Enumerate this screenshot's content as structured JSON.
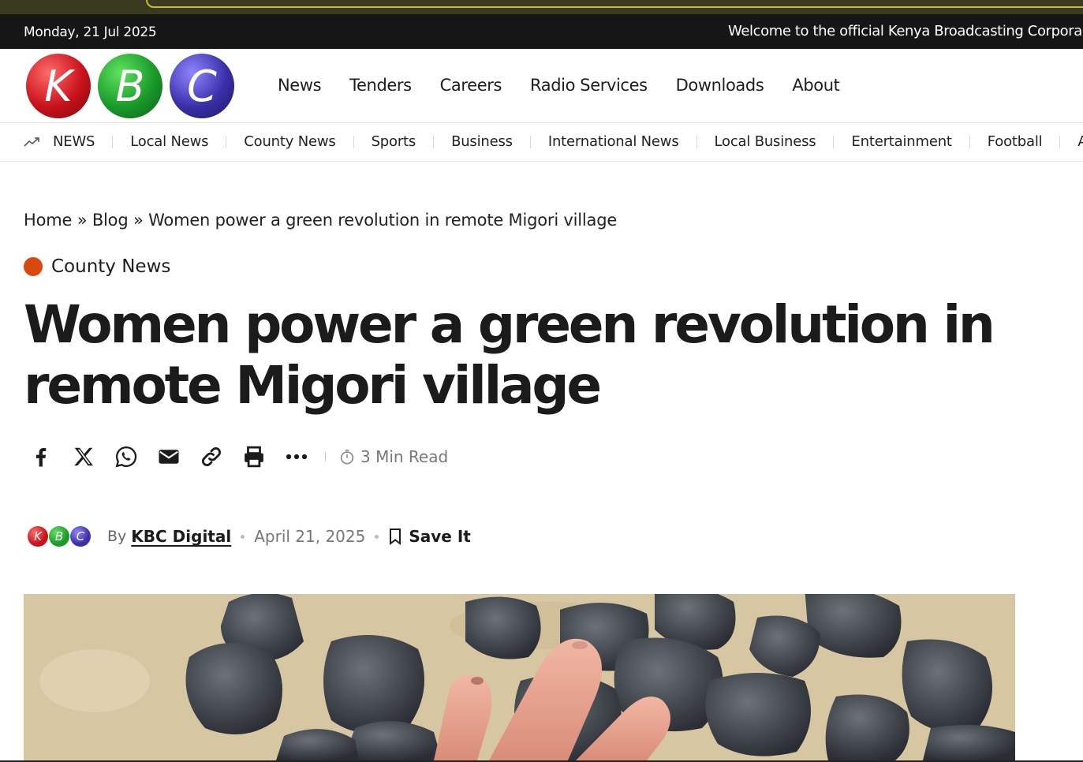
{
  "topbar": {
    "date": "Monday, 21 Jul 2025",
    "ticker": "Welcome to the official Kenya Broadcasting Corpora"
  },
  "logo": {
    "letters": [
      "K",
      "B",
      "C"
    ]
  },
  "main_nav": [
    "News",
    "Tenders",
    "Careers",
    "Radio Services",
    "Downloads",
    "About"
  ],
  "category_nav": {
    "icon": "trending-up-icon",
    "items": [
      "NEWS",
      "Local News",
      "County News",
      "Sports",
      "Business",
      "International News",
      "Local Business",
      "Entertainment",
      "Football",
      "Af"
    ]
  },
  "breadcrumb": {
    "home": "Home",
    "separator": "»",
    "blog": "Blog",
    "current": "Women power a green revolution in remote Migori village"
  },
  "article": {
    "category": "County News",
    "category_color": "#d9480f",
    "title": "Women power a green revolution in remote Migori village",
    "read_time": "3 Min Read",
    "by_label": "By",
    "author": "KBC Digital",
    "date": "April 21, 2025",
    "save_label": "Save It"
  },
  "share_icons": [
    "facebook-icon",
    "x-icon",
    "whatsapp-icon",
    "email-icon",
    "link-icon",
    "print-icon",
    "more-icon"
  ],
  "colors": {
    "topbar_bg": "#161616",
    "kbc_red": "#c8121b",
    "kbc_green": "#1a9a2a",
    "kbc_blue": "#3a2fa8"
  }
}
